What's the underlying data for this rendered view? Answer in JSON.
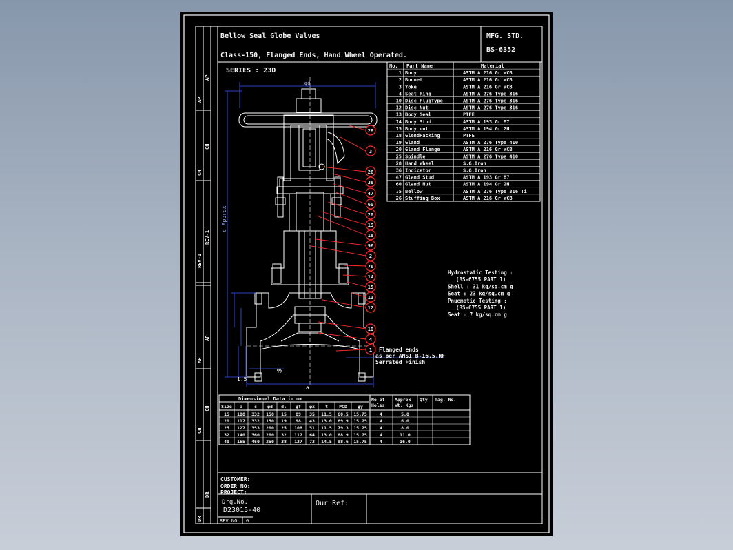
{
  "title_block": {
    "title": "Bellow Seal Globe Valves",
    "subtitle": "Class-150, Flanged Ends, Hand Wheel Operated.",
    "mfg_label": "MFG. STD.",
    "mfg_std": "BS-6352",
    "series": "SERIES : 23D",
    "customer": "CUSTOMER:",
    "order_no": "ORDER NO:",
    "project": "PROJECT:",
    "drg_label": "Drg.No.",
    "drg_no": "D23015-40",
    "our_ref": "Our Ref:",
    "rev_no": "REV NO.",
    "rev_val": "0"
  },
  "side_labels": [
    "AP",
    "AP",
    "CH",
    "CH",
    "REV-1",
    "REV-1",
    "AP",
    "AP",
    "CH",
    "CH",
    "DR",
    "DR"
  ],
  "parts_table": {
    "headers": [
      "No.",
      "Part Name",
      "Material"
    ],
    "rows": [
      [
        "1",
        "Body",
        "ASTM A 216 Gr WCB"
      ],
      [
        "2",
        "Bonnet",
        "ASTM A 216 Gr WCB"
      ],
      [
        "3",
        "Yoke",
        "ASTM A 216 Gr WCB"
      ],
      [
        "4",
        "Seat Ring",
        "ASTM A 276 Type 316"
      ],
      [
        "10",
        "Disc PlugType",
        "ASTM A 276 Type 316"
      ],
      [
        "12",
        "Disc Nut",
        "ASTM A 276 Type 316"
      ],
      [
        "13",
        "Body Seal",
        "PTFE"
      ],
      [
        "14",
        "Body Stud",
        "ASTM A 193 Gr B7"
      ],
      [
        "15",
        "Body nut",
        "ASTM A 194 Gr 2H"
      ],
      [
        "18",
        "GlendPacking",
        "PTFE"
      ],
      [
        "19",
        "Gland",
        "ASTM A 276 Type 410"
      ],
      [
        "20",
        "Gland Flange",
        "ASTM A 216 Gr WCB"
      ],
      [
        "25",
        "Spindle",
        "ASTM A 276 Type 410"
      ],
      [
        "28",
        "Hand Wheel",
        "S.G.Iron"
      ],
      [
        "36",
        "Indicator",
        "S.G.Iron"
      ],
      [
        "47",
        "Gland Stud",
        "ASTM A 193 Gr B7"
      ],
      [
        "60",
        "Gland Nut",
        "ASTM A 194 Gr 2H"
      ],
      [
        "75",
        "Bellow",
        "ASTM A 276 Type 316 Ti"
      ],
      [
        "26",
        "Stuffing Box",
        "ASTM A 216 Gr WCB"
      ]
    ]
  },
  "testing": [
    "Hydrostatic Testing :",
    "(BS-6755 PART 1)",
    "Shell : 31 kg/sq.cm g",
    "Seat  : 23 kg/sq.cm g",
    "Pnuematic Testing :",
    "(BS-6755 PART 1)",
    "Seat : 7 kg/sq.cm g"
  ],
  "balloons": [
    "28",
    "3",
    "26",
    "38",
    "47",
    "60",
    "20",
    "19",
    "18",
    "96",
    "2",
    "76",
    "14",
    "15",
    "13",
    "12",
    "10",
    "4",
    "1"
  ],
  "flange_note": [
    "Flanged ends",
    "as per ANSI B-16.5,RF",
    "Serrated Finish"
  ],
  "dims": {
    "top": "φd",
    "height": "c Approx",
    "bottom": "a",
    "small": "1.5",
    "dy": "φy"
  },
  "dim_table": {
    "title": "Dimensional Data in mm",
    "headers": [
      "Size",
      "a",
      "c",
      "φd",
      "d₀",
      "φf",
      "φx",
      "t",
      "PCD",
      "φy"
    ],
    "rows": [
      [
        "15",
        "108",
        "332",
        "150",
        "15",
        "89",
        "35",
        "11.5",
        "60.5",
        "15.75"
      ],
      [
        "20",
        "117",
        "332",
        "150",
        "19",
        "98",
        "43",
        "13.0",
        "69.9",
        "15.75"
      ],
      [
        "25",
        "127",
        "353",
        "200",
        "25",
        "108",
        "51",
        "11.5",
        "79.3",
        "15.75"
      ],
      [
        "32",
        "140",
        "360",
        "200",
        "32",
        "117",
        "64",
        "13.0",
        "88.9",
        "15.75"
      ],
      [
        "40",
        "165",
        "460",
        "250",
        "38",
        "127",
        "73",
        "14.5",
        "98.6",
        "15.75"
      ]
    ],
    "extra_headers": [
      [
        "No of",
        "Holes"
      ],
      [
        "Approx",
        "Wt. Kgs"
      ],
      [
        "Qty"
      ],
      [
        "Tag. No."
      ]
    ],
    "extra_rows": [
      [
        "4",
        "5.0"
      ],
      [
        "4",
        "6.0"
      ],
      [
        "4",
        "8.0"
      ],
      [
        "4",
        "11.0"
      ],
      [
        "4",
        "16.0"
      ]
    ]
  },
  "colors": {
    "sheet": "#000000",
    "line": "#ffffff",
    "leader": "#ff2a2a",
    "dim": "#3a5bff",
    "desk": "#99a6b7"
  }
}
